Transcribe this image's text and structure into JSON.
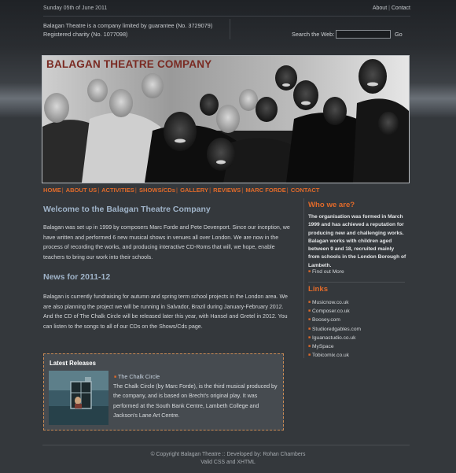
{
  "top": {
    "date": "Sunday 05th of June 2011",
    "about_label": "About",
    "separator": "|",
    "contact_label": "Contact"
  },
  "company": {
    "line1": "Balagan Theatre is a company limited by guarantee (No. 3729079)",
    "line2": "Registered charity (No. 1077098)"
  },
  "search": {
    "label": "Search the Web:",
    "value": "",
    "go_label": "Go"
  },
  "hero": {
    "title": "BALAGAN THEATRE COMPANY"
  },
  "nav": {
    "items": [
      "HOME",
      "ABOUT US",
      "ACTIVITIES",
      "SHOWS/CDs",
      "GALLERY",
      "REVIEWS",
      "MARC FORDE",
      "CONTACT"
    ],
    "separator": "|"
  },
  "main": {
    "welcome_title": "Welcome to the Balagan Theatre Company",
    "welcome_text": "Balagan was set up in 1999 by composers Marc Forde and Pete Devenport. Since our inception, we have written and performed 6 new musical shows in venues all over London. We are now in the process of recording the works, and producing interactive CD-Roms that will, we hope, enable teachers to bring our work into their schools.",
    "news_title": "News for 2011-12",
    "news_text": "Balagan is currently fundraising for autumn and spring term school projects in the London area. We are also planning the project we will be running in Salvador, Brazil during January-February 2012. And the CD of The Chalk Circle will be released later this year, with Hansel and Gretel in 2012. You can listen to the songs to all of our CDs on the Shows/Cds page."
  },
  "sidebar": {
    "who_title": "Who we are?",
    "who_text": "The organisation was formed in March 1999 and has achieved a reputation for producing new and challenging works. Balagan works with children aged between 9 and 18, recruited mainly from schools in the London Borough of Lambeth.",
    "find_out_more": "Find out More",
    "links_title": "Links",
    "links": [
      "Musicnow.co.uk",
      "Composer.co.uk",
      "Boosey.com",
      "Studioredgables.com",
      "Iguanastudio.co.uk",
      "MySpace",
      "Tobicomix.co.uk"
    ]
  },
  "releases": {
    "title": "Latest Releases",
    "item_title": "The Chalk Circle",
    "item_text": "The Chalk Circle (by Marc Forde), is the third musical produced by the company, and is based on Brecht's original play. It was performed at the South Bank Centre, Lambeth College and Jackson's Lane Art Centre."
  },
  "footer": {
    "line1": "© Copyright Balagan Theatre :: Developed by: Rohan Chambers",
    "line2": "Valid CSS and XHTML"
  },
  "colors": {
    "accent": "#e06a2a",
    "heading_blue": "#9fb3c8",
    "background": "#34383c",
    "hero_title": "#7a2a22"
  },
  "icons": {
    "bullet": "bullet-icon"
  }
}
